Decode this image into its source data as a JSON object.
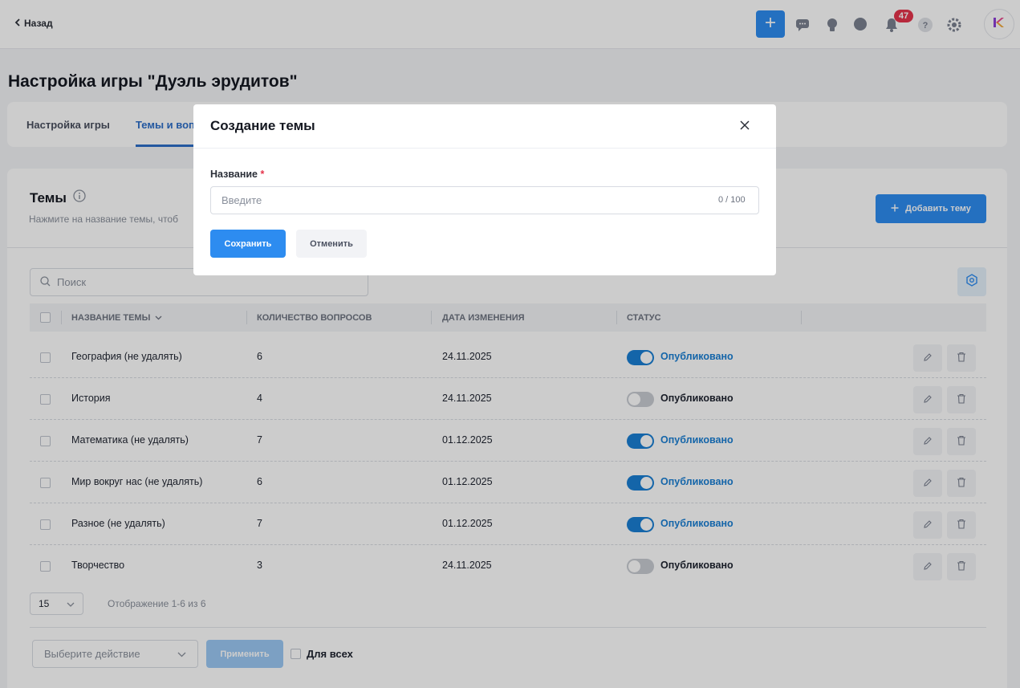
{
  "header": {
    "back_label": "Назад",
    "notifications_count": "47"
  },
  "page": {
    "title": "Настройка игры \"Дуэль эрудитов\""
  },
  "tabs": [
    {
      "label": "Настройка игры",
      "active": false
    },
    {
      "label": "Темы и воп",
      "active": true
    }
  ],
  "themes": {
    "title": "Темы",
    "subtitle": "Нажмите на название темы, чтоб",
    "add_button": "Добавить тему",
    "search_placeholder": "Поиск"
  },
  "table": {
    "columns": [
      "НАЗВАНИЕ ТЕМЫ",
      "КОЛИЧЕСТВО ВОПРОСОВ",
      "ДАТА ИЗМЕНЕНИЯ",
      "СТАТУС"
    ],
    "rows": [
      {
        "name": "География (не удалять)",
        "count": "6",
        "date": "24.11.2025",
        "status": "Опубликовано",
        "published": true
      },
      {
        "name": "История",
        "count": "4",
        "date": "24.11.2025",
        "status": "Опубликовано",
        "published": false
      },
      {
        "name": "Математика (не удалять)",
        "count": "7",
        "date": "01.12.2025",
        "status": "Опубликовано",
        "published": true
      },
      {
        "name": "Мир вокруг нас (не удалять)",
        "count": "6",
        "date": "01.12.2025",
        "status": "Опубликовано",
        "published": true
      },
      {
        "name": "Разное (не удалять)",
        "count": "7",
        "date": "01.12.2025",
        "status": "Опубликовано",
        "published": true
      },
      {
        "name": "Творчество",
        "count": "3",
        "date": "24.11.2025",
        "status": "Опубликовано",
        "published": false
      }
    ]
  },
  "pagination": {
    "per_page": "15",
    "info": "Отображение 1-6 из 6"
  },
  "bulk": {
    "action_placeholder": "Выберите действие",
    "apply_label": "Применить",
    "for_all_label": "Для всех"
  },
  "modal": {
    "title": "Создание темы",
    "field_label": "Название",
    "required_mark": "*",
    "input_placeholder": "Введите",
    "input_value": "",
    "counter": "0 / 100",
    "save_label": "Сохранить",
    "cancel_label": "Отменить"
  },
  "colors": {
    "accent": "#2d8cf0",
    "published": "#1a7fd4",
    "badge": "#e5344b"
  }
}
